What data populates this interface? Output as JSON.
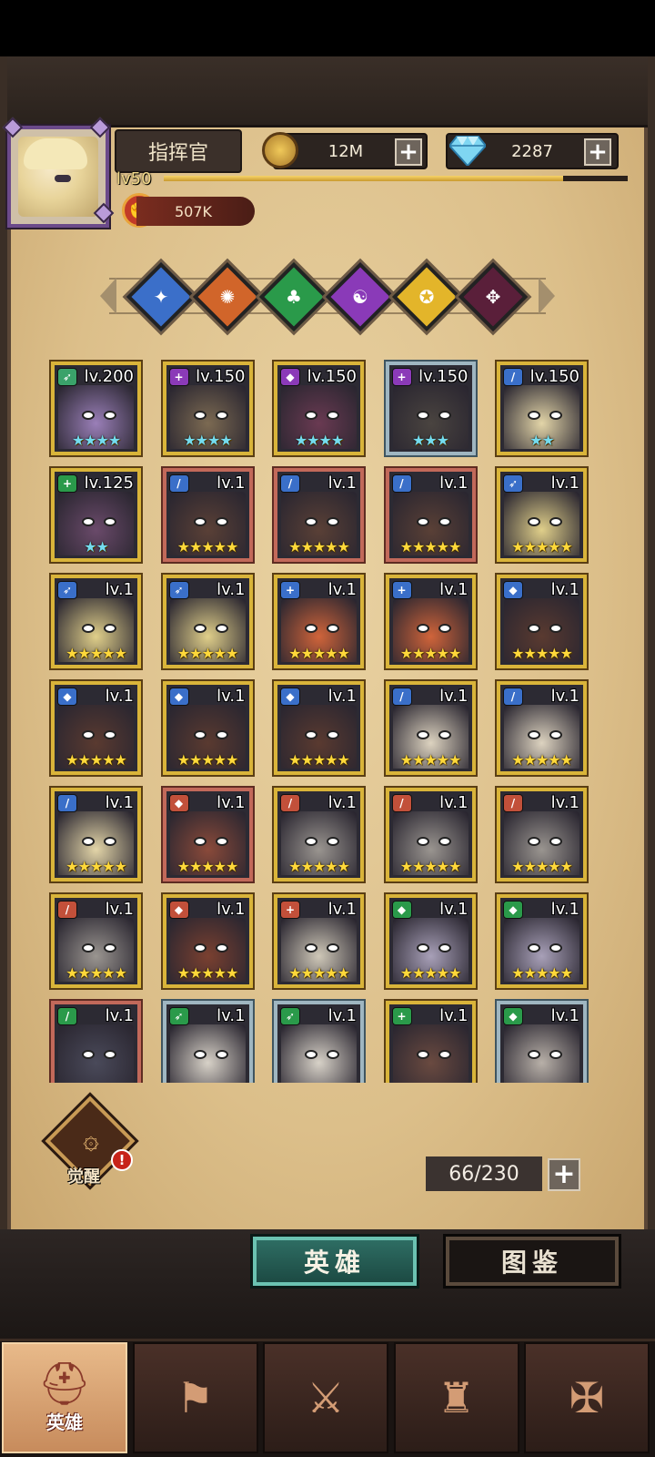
{
  "header": {
    "player_name": "指挥官",
    "level": "lv50",
    "exp_fraction": 0.86,
    "power": "507K",
    "gold": "12M",
    "gems": "2287"
  },
  "factions": [
    {
      "icon": "blue-faction-icon",
      "color": "#3b6fc9"
    },
    {
      "icon": "orange-faction-icon",
      "color": "#d1652a"
    },
    {
      "icon": "green-faction-icon",
      "color": "#2a9a4a"
    },
    {
      "icon": "purple-faction-icon",
      "color": "#8a3ab8"
    },
    {
      "icon": "yellow-faction-icon",
      "color": "#e3b52a"
    },
    {
      "icon": "dark-faction-icon",
      "color": "#5a1f3a"
    }
  ],
  "heroes": [
    {
      "level": "lv.200",
      "stars": "★★★★",
      "star_color": "cyan",
      "role": "bow",
      "role_color": "#3aa26a",
      "portrait": "#9a7fb8",
      "frame": "gold"
    },
    {
      "level": "lv.150",
      "stars": "★★★★",
      "star_color": "cyan",
      "role": "plus",
      "role_color": "#8b3ab8",
      "portrait": "#7c6a52",
      "frame": "gold"
    },
    {
      "level": "lv.150",
      "stars": "★★★★",
      "star_color": "cyan",
      "role": "shield",
      "role_color": "#8b3ab8",
      "portrait": "#6a3a52",
      "frame": "gold"
    },
    {
      "level": "lv.150",
      "stars": "★★★",
      "star_color": "cyan",
      "role": "plus",
      "role_color": "#8b3ab8",
      "portrait": "#4a4440",
      "frame": "rare"
    },
    {
      "level": "lv.150",
      "stars": "★★",
      "star_color": "cyan",
      "role": "sword",
      "role_color": "#3a6fc9",
      "portrait": "#e3d5a8",
      "frame": "gold"
    },
    {
      "level": "lv.125",
      "stars": "★★",
      "star_color": "cyan",
      "role": "plus",
      "role_color": "#2a9a4a",
      "portrait": "#6a4a6a",
      "frame": "gold"
    },
    {
      "level": "lv.1",
      "stars": "★★★★★",
      "star_color": "gold",
      "role": "sword",
      "role_color": "#3a6fc9",
      "portrait": "#5a4036",
      "frame": "red"
    },
    {
      "level": "lv.1",
      "stars": "★★★★★",
      "star_color": "gold",
      "role": "sword",
      "role_color": "#3a6fc9",
      "portrait": "#5a4036",
      "frame": "red"
    },
    {
      "level": "lv.1",
      "stars": "★★★★★",
      "star_color": "gold",
      "role": "sword",
      "role_color": "#3a6fc9",
      "portrait": "#5a4036",
      "frame": "red"
    },
    {
      "level": "lv.1",
      "stars": "★★★★★",
      "star_color": "gold",
      "role": "bow",
      "role_color": "#3a6fc9",
      "portrait": "#e0cf8a",
      "frame": "gold"
    },
    {
      "level": "lv.1",
      "stars": "★★★★★",
      "star_color": "gold",
      "role": "bow",
      "role_color": "#3a6fc9",
      "portrait": "#e0cf8a",
      "frame": "gold"
    },
    {
      "level": "lv.1",
      "stars": "★★★★★",
      "star_color": "gold",
      "role": "bow",
      "role_color": "#3a6fc9",
      "portrait": "#e0cf8a",
      "frame": "gold"
    },
    {
      "level": "lv.1",
      "stars": "★★★★★",
      "star_color": "gold",
      "role": "plus",
      "role_color": "#3a6fc9",
      "portrait": "#d0643a",
      "frame": "gold"
    },
    {
      "level": "lv.1",
      "stars": "★★★★★",
      "star_color": "gold",
      "role": "plus",
      "role_color": "#3a6fc9",
      "portrait": "#d0643a",
      "frame": "gold"
    },
    {
      "level": "lv.1",
      "stars": "★★★★★",
      "star_color": "gold",
      "role": "shield",
      "role_color": "#3a6fc9",
      "portrait": "#5a3a30",
      "frame": "gold"
    },
    {
      "level": "lv.1",
      "stars": "★★★★★",
      "star_color": "gold",
      "role": "shield",
      "role_color": "#3a6fc9",
      "portrait": "#5a3a30",
      "frame": "gold"
    },
    {
      "level": "lv.1",
      "stars": "★★★★★",
      "star_color": "gold",
      "role": "shield",
      "role_color": "#3a6fc9",
      "portrait": "#5a3a30",
      "frame": "gold"
    },
    {
      "level": "lv.1",
      "stars": "★★★★★",
      "star_color": "gold",
      "role": "shield",
      "role_color": "#3a6fc9",
      "portrait": "#5a3a30",
      "frame": "gold"
    },
    {
      "level": "lv.1",
      "stars": "★★★★★",
      "star_color": "gold",
      "role": "sword",
      "role_color": "#3a6fc9",
      "portrait": "#ddd3c0",
      "frame": "gold"
    },
    {
      "level": "lv.1",
      "stars": "★★★★★",
      "star_color": "gold",
      "role": "sword",
      "role_color": "#3a6fc9",
      "portrait": "#ddd3c0",
      "frame": "gold"
    },
    {
      "level": "lv.1",
      "stars": "★★★★★",
      "star_color": "gold",
      "role": "sword",
      "role_color": "#3a6fc9",
      "portrait": "#e3d5a8",
      "frame": "gold"
    },
    {
      "level": "lv.1",
      "stars": "★★★★★",
      "star_color": "gold",
      "role": "shield",
      "role_color": "#c2503a",
      "portrait": "#8a4a3a",
      "frame": "red"
    },
    {
      "level": "lv.1",
      "stars": "★★★★★",
      "star_color": "gold",
      "role": "sword",
      "role_color": "#c2503a",
      "portrait": "#9a9590",
      "frame": "gold"
    },
    {
      "level": "lv.1",
      "stars": "★★★★★",
      "star_color": "gold",
      "role": "sword",
      "role_color": "#c2503a",
      "portrait": "#9a9590",
      "frame": "gold"
    },
    {
      "level": "lv.1",
      "stars": "★★★★★",
      "star_color": "gold",
      "role": "sword",
      "role_color": "#c2503a",
      "portrait": "#9a9590",
      "frame": "gold"
    },
    {
      "level": "lv.1",
      "stars": "★★★★★",
      "star_color": "gold",
      "role": "sword",
      "role_color": "#c2503a",
      "portrait": "#9a9590",
      "frame": "gold"
    },
    {
      "level": "lv.1",
      "stars": "★★★★★",
      "star_color": "gold",
      "role": "shield",
      "role_color": "#c2503a",
      "portrait": "#7a4030",
      "frame": "gold"
    },
    {
      "level": "lv.1",
      "stars": "★★★★★",
      "star_color": "gold",
      "role": "plus",
      "role_color": "#c2503a",
      "portrait": "#cfc8b8",
      "frame": "gold"
    },
    {
      "level": "lv.1",
      "stars": "★★★★★",
      "star_color": "gold",
      "role": "shield",
      "role_color": "#2a9a4a",
      "portrait": "#a8a0b8",
      "frame": "gold"
    },
    {
      "level": "lv.1",
      "stars": "★★★★★",
      "star_color": "gold",
      "role": "shield",
      "role_color": "#2a9a4a",
      "portrait": "#a8a0b8",
      "frame": "gold"
    },
    {
      "level": "lv.1",
      "stars": "",
      "star_color": "gold",
      "role": "sword",
      "role_color": "#2a9a4a",
      "portrait": "#4a4a5a",
      "frame": "red"
    },
    {
      "level": "lv.1",
      "stars": "",
      "star_color": "gold",
      "role": "bow",
      "role_color": "#2a9a4a",
      "portrait": "#d8d2c8",
      "frame": "rare"
    },
    {
      "level": "lv.1",
      "stars": "",
      "star_color": "gold",
      "role": "bow",
      "role_color": "#2a9a4a",
      "portrait": "#d8d2c8",
      "frame": "rare"
    },
    {
      "level": "lv.1",
      "stars": "",
      "star_color": "gold",
      "role": "plus",
      "role_color": "#2a9a4a",
      "portrait": "#6a4a40",
      "frame": "gold"
    },
    {
      "level": "lv.1",
      "stars": "",
      "star_color": "gold",
      "role": "shield",
      "role_color": "#2a9a4a",
      "portrait": "#b8b0a8",
      "frame": "rare"
    }
  ],
  "awaken": {
    "label": "觉醒",
    "alert": "!"
  },
  "hero_count": "66/230",
  "tabs": {
    "heroes": "英雄",
    "codex": "图鉴"
  },
  "nav": [
    {
      "label": "英雄",
      "icon": "hero-helmet-icon",
      "active": true
    },
    {
      "label": "",
      "icon": "flag-map-icon",
      "active": false
    },
    {
      "label": "",
      "icon": "crossed-swords-icon",
      "active": false
    },
    {
      "label": "",
      "icon": "castle-tower-icon",
      "active": false
    },
    {
      "label": "",
      "icon": "guild-emblem-icon",
      "active": false
    }
  ]
}
